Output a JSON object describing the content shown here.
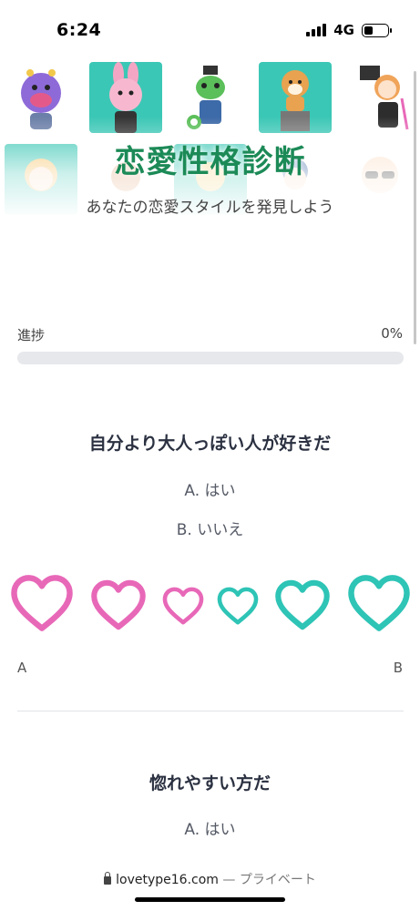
{
  "status_bar": {
    "time": "6:24",
    "network": "4G"
  },
  "hero": {
    "title": "恋愛性格診断",
    "subtitle": "あなたの恋愛スタイルを発見しよう",
    "characters": [
      {
        "name": "purple-alien-character-icon",
        "bg": "#ffffff"
      },
      {
        "name": "pink-bunny-character-icon",
        "bg": "#3bc7b5"
      },
      {
        "name": "green-chameleon-character-icon",
        "bg": "#ffffff"
      },
      {
        "name": "shiba-dog-character-icon",
        "bg": "#3bc7b5"
      },
      {
        "name": "magician-girl-character-icon",
        "bg": "#ffffff"
      },
      {
        "name": "blond-boy-character-icon",
        "bg": "#3bc7b5"
      },
      {
        "name": "sunglasses-baby-character-icon",
        "bg": "#ffffff"
      }
    ]
  },
  "progress": {
    "label": "進捗",
    "value_text": "0%",
    "value": 0
  },
  "questions": [
    {
      "text": "自分より大人っぽい人が好きだ",
      "option_a": "A. はい",
      "option_b": "B. いいえ"
    },
    {
      "text": "惚れやすい方だ",
      "option_a": "A. はい"
    }
  ],
  "scale": {
    "label_a": "A",
    "label_b": "B",
    "colors": {
      "a": "#e868b8",
      "b": "#2ec4b6"
    }
  },
  "address_bar": {
    "domain": "lovetype16.com",
    "suffix": " — プライベート"
  }
}
